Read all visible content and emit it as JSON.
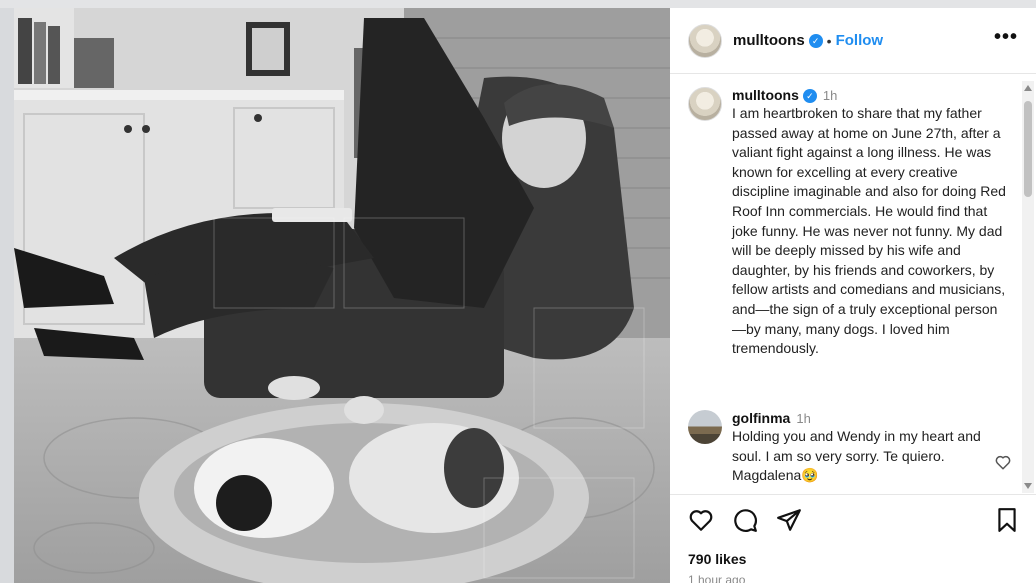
{
  "header": {
    "username": "mulltoons",
    "separator": "•",
    "follow_label": "Follow",
    "more_label": "•••"
  },
  "caption": {
    "username": "mulltoons",
    "time": "1h",
    "text": "I am heartbroken to share that my father passed away at home on June 27th, after a valiant fight against a long illness. He was known for excelling at every creative discipline imaginable and also for doing Red Roof Inn commercials. He would find that joke funny. He was never not funny. My dad will be deeply missed by his wife and daughter, by his friends and coworkers, by fellow artists and comedians and musicians, and—the sign of a truly exceptional person—by many, many dogs. I loved him tremendously."
  },
  "comments": [
    {
      "username": "golfinma",
      "time": "1h",
      "text": "Holding you and Wendy in my heart and soul. I am so very sorry. Te quiero. Magdalena🥹"
    }
  ],
  "footer": {
    "likes": "790 likes",
    "time_ago": "1 hour ago"
  },
  "icons": {
    "verified": "verified-badge-icon",
    "like": "heart-icon",
    "comment": "comment-bubble-icon",
    "share": "paper-plane-icon",
    "save": "bookmark-icon"
  },
  "colors": {
    "accent": "#1f8df0",
    "muted": "#8a8a8a"
  }
}
